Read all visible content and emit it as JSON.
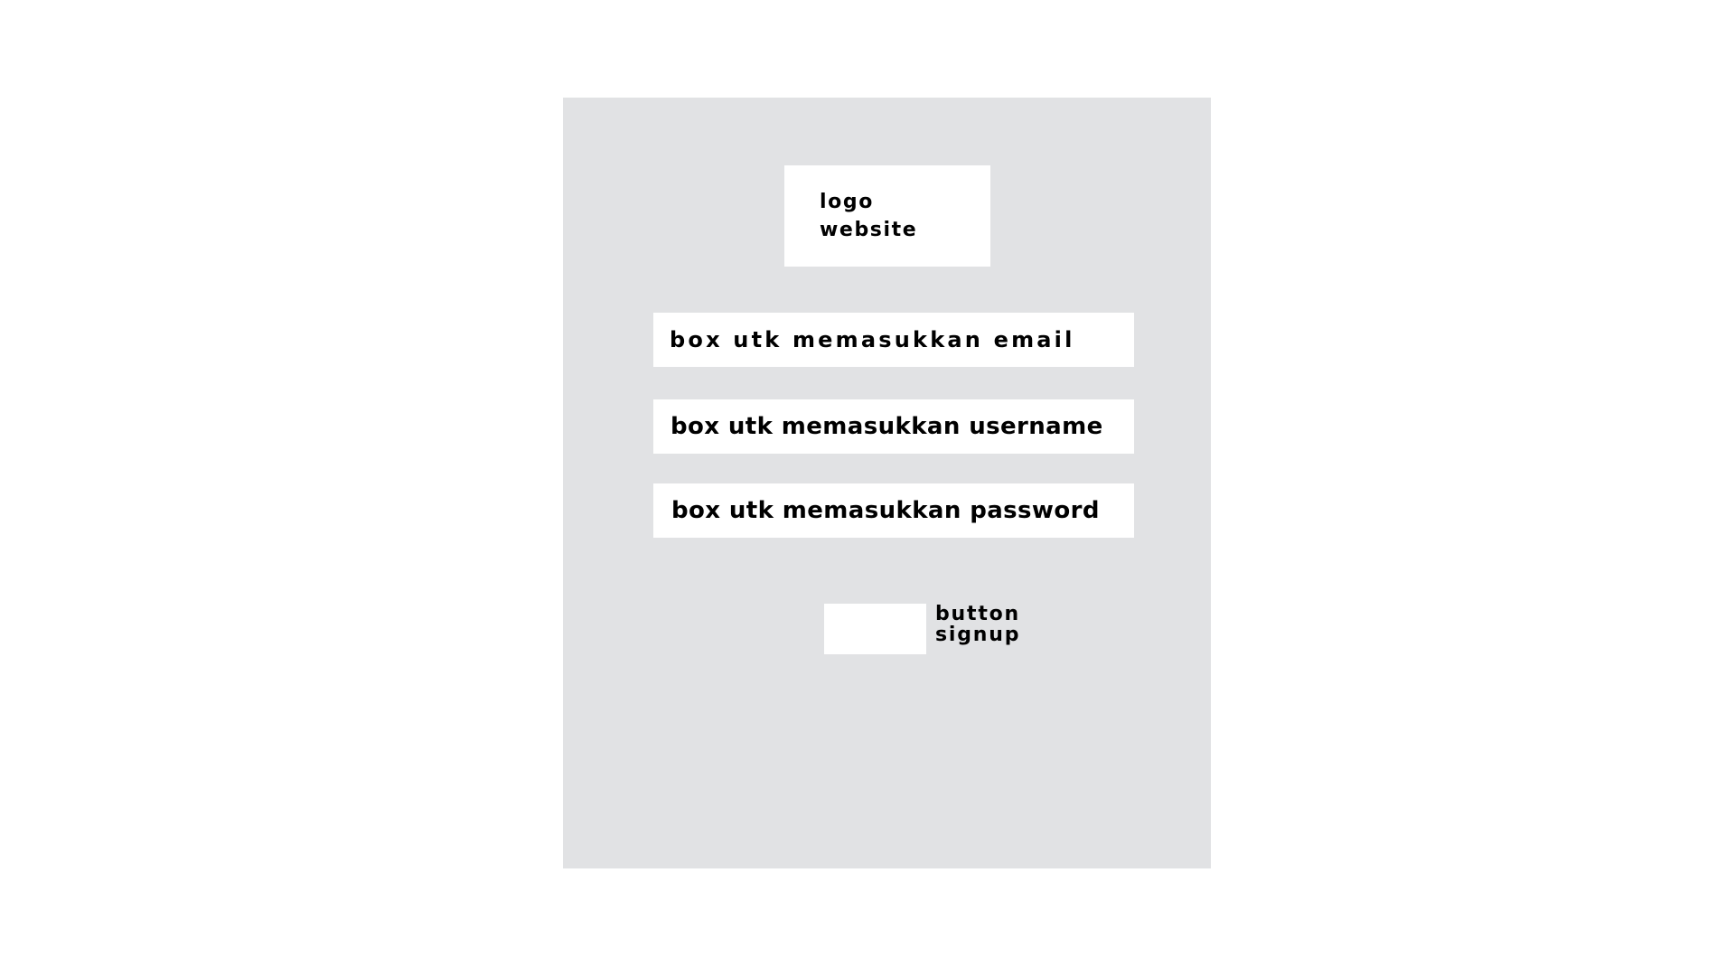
{
  "logo": {
    "line1": "logo",
    "line2": "website"
  },
  "form": {
    "email_label": "box utk memasukkan email",
    "username_label": "box utk memasukkan username",
    "password_label": "box utk memasukkan password"
  },
  "signup": {
    "line1": "button",
    "line2": "signup"
  },
  "colors": {
    "background": "#ffffff",
    "panel": "#e1e2e4",
    "box": "#ffffff",
    "text": "#000000"
  }
}
